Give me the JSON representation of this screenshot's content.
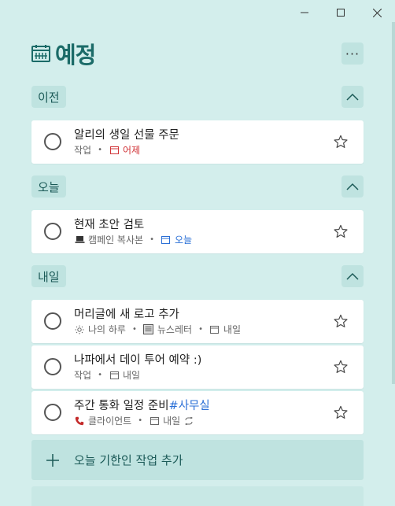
{
  "window": {
    "controls": [
      "minimize-icon",
      "maximize-icon",
      "close-icon"
    ]
  },
  "header": {
    "title": "예정",
    "icon": "calendar-icon",
    "more_label": "···"
  },
  "groups": [
    {
      "label": "이전",
      "tasks": [
        {
          "title": "알리의 생일 선물 주문",
          "list": "작업",
          "due": "어제",
          "due_color": "#d13438"
        }
      ]
    },
    {
      "label": "오늘",
      "tasks": [
        {
          "title": "현재 초안 검토",
          "list": "캠페인 복사본",
          "list_icon": "laptop-icon",
          "due": "오늘",
          "due_color": "#2a6fd6"
        }
      ]
    },
    {
      "label": "내일",
      "tasks": [
        {
          "title": "머리글에 새 로고 추가",
          "myday": "나의 하루",
          "list": "뉴스레터",
          "list_icon": "newspaper-icon",
          "due": "내일"
        },
        {
          "title": "나파에서 데이 투어 예약 :)",
          "list": "작업",
          "due": "내일"
        },
        {
          "title": "주간 통화 일정 준비",
          "tag": "#사무실",
          "list": "클라이언트",
          "list_icon": "phone-icon",
          "due": "내일",
          "repeat": "repeat-icon"
        }
      ]
    }
  ],
  "add_task": {
    "label": "오늘 기한인 작업 추가"
  },
  "colors": {
    "background": "#d3eeec",
    "accent": "#1b6b68",
    "overdue": "#d13438",
    "today": "#2a6fd6"
  }
}
